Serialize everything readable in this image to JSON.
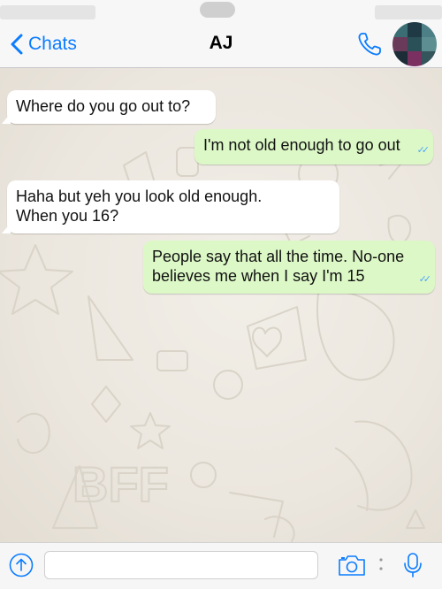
{
  "header": {
    "back_label": "Chats",
    "title": "AJ",
    "call_icon": "phone-icon",
    "avatar_colors": [
      "#3a6e74",
      "#1f3a44",
      "#4d7f86",
      "#6a3a5a",
      "#2a5058",
      "#5c8e92",
      "#1d2d38",
      "#7a3060",
      "#34555c"
    ]
  },
  "messages": [
    {
      "direction": "incoming",
      "text": "Where do you go out to?"
    },
    {
      "direction": "outgoing",
      "text": "I'm not old enough to go out",
      "status": "read"
    },
    {
      "direction": "incoming",
      "text": "Haha but yeh you look old enough.\nWhen you 16?"
    },
    {
      "direction": "outgoing",
      "text": "People say that all the time. No-one\nbelieves me when I say I'm 15",
      "status": "read"
    }
  ],
  "input_bar": {
    "placeholder": "",
    "icons": [
      "share-icon",
      "camera-icon",
      "mic-icon"
    ]
  },
  "colors": {
    "accent": "#0a7cff",
    "incoming_bubble": "#ffffff",
    "outgoing_bubble": "#dcf8c6",
    "read_ticks": "#4fa7ff"
  }
}
